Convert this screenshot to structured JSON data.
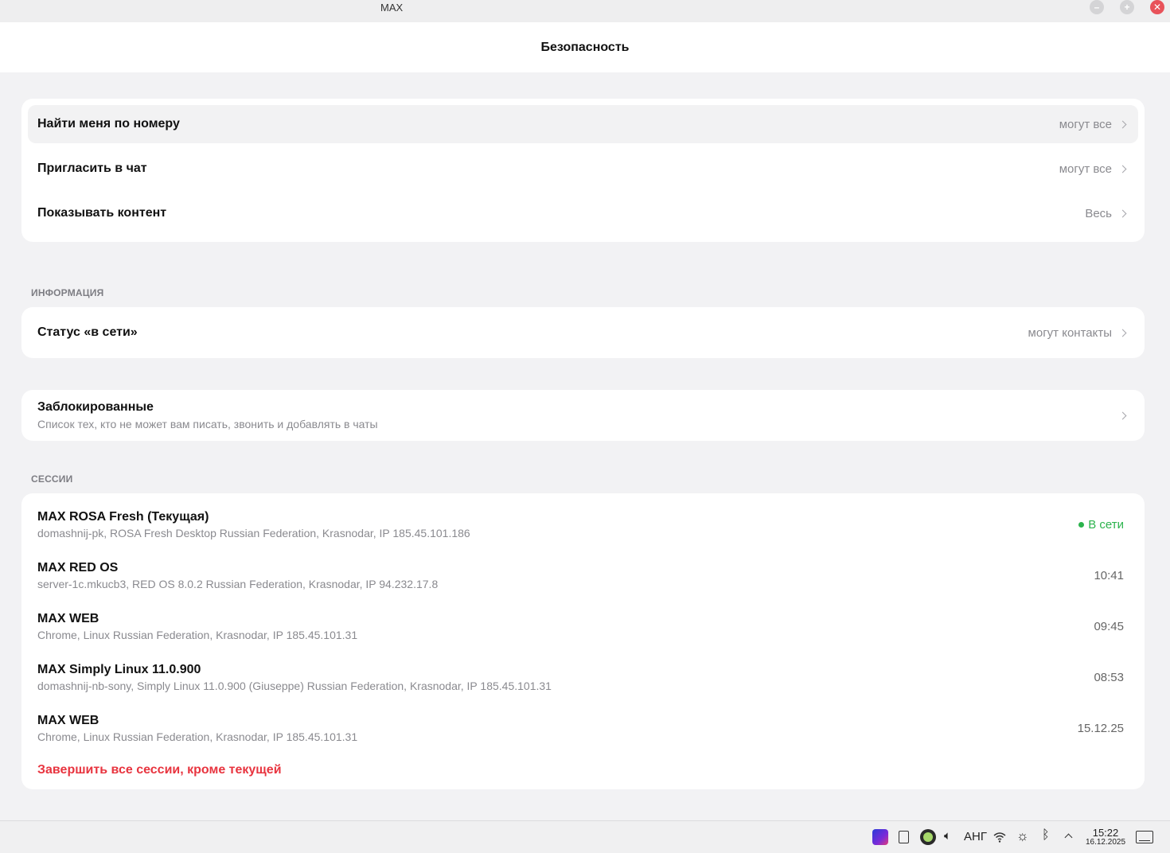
{
  "window": {
    "title": "MAX"
  },
  "header": {
    "title": "Безопасность"
  },
  "privacy": [
    {
      "label": "Найти меня по номеру",
      "value": "могут все"
    },
    {
      "label": "Пригласить в чат",
      "value": "могут все"
    },
    {
      "label": "Показывать контент",
      "value": "Весь"
    }
  ],
  "info": {
    "section_label": "ИНФОРМАЦИЯ",
    "status": {
      "label": "Статус «в сети»",
      "value": "могут контакты"
    }
  },
  "blocked": {
    "title": "Заблокированные",
    "subtitle": "Список тех, кто не может вам писать, звонить и добавлять в чаты"
  },
  "sessions": {
    "section_label": "СЕССИИ",
    "items": [
      {
        "name": "MAX ROSA Fresh (Текущая)",
        "meta": "domashnij-pk, ROSA Fresh Desktop Russian Federation, Krasnodar, IP 185.45.101.186",
        "status": "В сети"
      },
      {
        "name": "MAX RED OS",
        "meta": "server-1c.mkucb3, RED OS 8.0.2 Russian Federation, Krasnodar, IP 94.232.17.8",
        "time": "10:41"
      },
      {
        "name": "MAX WEB",
        "meta": "Chrome, Linux Russian Federation, Krasnodar, IP 185.45.101.31",
        "time": "09:45"
      },
      {
        "name": "MAX Simply Linux 11.0.900",
        "meta": "domashnij-nb-sony, Simply Linux 11.0.900 (Giuseppe) Russian Federation, Krasnodar, IP 185.45.101.31",
        "time": "08:53"
      },
      {
        "name": "MAX WEB",
        "meta": "Chrome, Linux Russian Federation, Krasnodar, IP 185.45.101.31",
        "time": "15.12.25"
      }
    ],
    "terminate_label": "Завершить все сессии, кроме текущей"
  },
  "taskbar": {
    "keyboard_layout": "АНГ",
    "time": "15:22",
    "date": "16.12.2025",
    "icons": [
      "app-icon",
      "clipboard-icon",
      "green-app-icon",
      "volume-icon",
      "wifi-icon",
      "brightness-icon",
      "bluetooth-icon",
      "tray-expand-icon",
      "show-desktop-icon"
    ]
  },
  "colors": {
    "accent_green": "#2bb34c",
    "danger_red": "#e8343f",
    "close_button": "#e8525a"
  }
}
